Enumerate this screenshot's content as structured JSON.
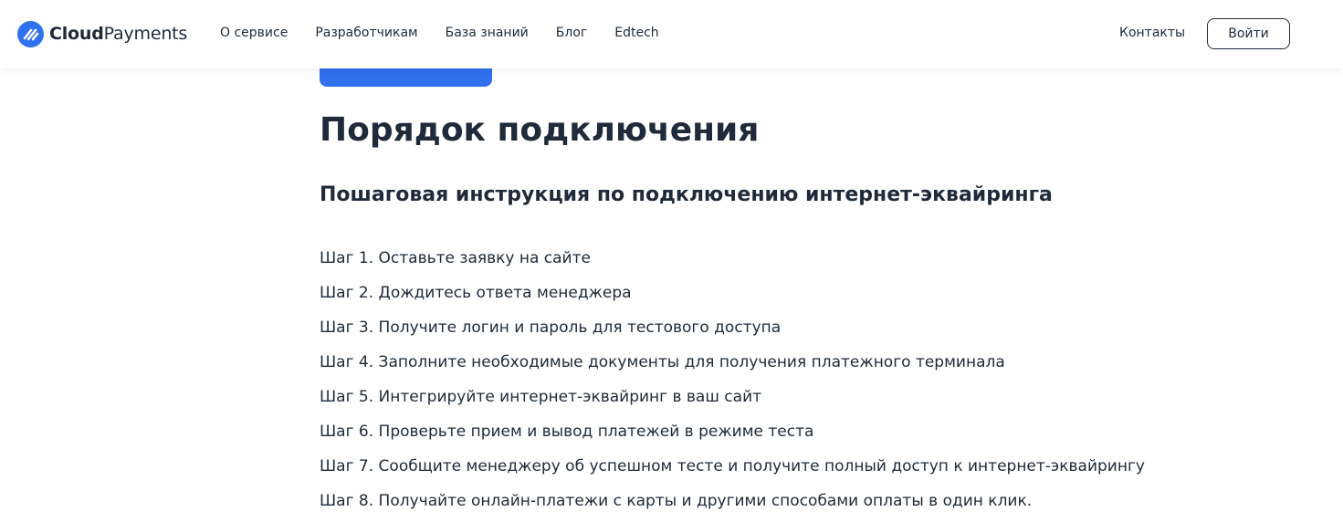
{
  "header": {
    "logo": {
      "bold": "Cloud",
      "regular": "Payments"
    },
    "nav": [
      "О сервисе",
      "Разработчикам",
      "База знаний",
      "Блог",
      "Edtech"
    ],
    "contacts": "Контакты",
    "login": "Войти"
  },
  "main": {
    "title": "Порядок подключения",
    "subtitle": "Пошаговая инструкция по подключению интернет-эквайринга",
    "steps": [
      "Шаг 1. Оставьте заявку на сайте",
      "Шаг 2. Дождитесь ответа менеджера",
      "Шаг 3. Получите логин и пароль для тестового доступа",
      "Шаг 4. Заполните необходимые документы для получения платежного терминала",
      "Шаг 5. Интегрируйте интернет-эквайринг в ваш сайт",
      "Шаг 6. Проверьте прием и вывод платежей в режиме теста",
      "Шаг 7. Сообщите менеджеру об успешном тесте и получите полный доступ к интернет-эквайрингу",
      "Шаг 8. Получайте онлайн-платежи с карты и другими способами оплаты в один клик."
    ]
  },
  "colors": {
    "accent": "#2f71ee",
    "text": "#1f2a3a"
  }
}
